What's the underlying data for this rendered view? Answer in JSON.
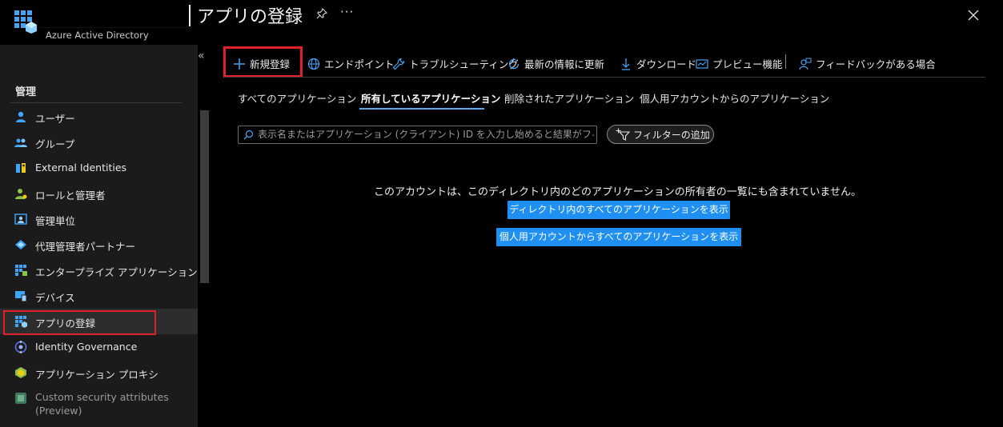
{
  "header": {
    "subtitle": "Azure Active Directory",
    "title": "アプリの登録",
    "more": "···"
  },
  "sidebar": {
    "collapse": "«",
    "section_label": "管理",
    "items": [
      {
        "label": "ユーザー",
        "icon": "user-icon"
      },
      {
        "label": "グループ",
        "icon": "group-icon"
      },
      {
        "label": "External Identities",
        "icon": "external-identities-icon"
      },
      {
        "label": "ロールと管理者",
        "icon": "roles-icon"
      },
      {
        "label": "管理単位",
        "icon": "admin-units-icon"
      },
      {
        "label": "代理管理者パートナー",
        "icon": "partner-icon"
      },
      {
        "label": "エンタープライズ アプリケーション",
        "icon": "enterprise-apps-icon"
      },
      {
        "label": "デバイス",
        "icon": "device-icon"
      },
      {
        "label": "アプリの登録",
        "icon": "app-registrations-icon",
        "active": true
      },
      {
        "label": "Identity Governance",
        "icon": "governance-icon"
      },
      {
        "label": "アプリケーション プロキシ",
        "icon": "app-proxy-icon"
      },
      {
        "label": "Custom security attributes",
        "label2": "(Preview)",
        "icon": "custom-attributes-icon"
      }
    ]
  },
  "toolbar": {
    "new_registration": "新規登録",
    "endpoints": "エンドポイント",
    "troubleshooting": "トラブルシューティング",
    "refresh": "最新の情報に更新",
    "download": "ダウンロード",
    "preview": "プレビュー機能",
    "feedback": "フィードバックがある場合"
  },
  "tabs": [
    {
      "label": "すべてのアプリケーション"
    },
    {
      "label": "所有しているアプリケーション",
      "selected": true
    },
    {
      "label": "削除されたアプリケーション"
    },
    {
      "label": "個人用アカウントからのアプリケーション"
    }
  ],
  "search": {
    "placeholder": "表示名またはアプリケーション (クライアント) ID を入力し始めると結果がフィル...",
    "value": ""
  },
  "filter": {
    "label": "フィルターの追加"
  },
  "empty": {
    "message": "このアカウントは、このディレクトリ内のどのアプリケーションの所有者の一覧にも含まれていません。",
    "btn_directory": "ディレクトリ内のすべてのアプリケーションを表示",
    "btn_personal": "個人用アカウントからすべてのアプリケーションを表示"
  },
  "colors": {
    "accent_blue": "#1f8ff2",
    "highlight_red": "#e0202d",
    "tab_underline": "#5ba8ee",
    "sidebar_bg": "#1b1b1b"
  }
}
